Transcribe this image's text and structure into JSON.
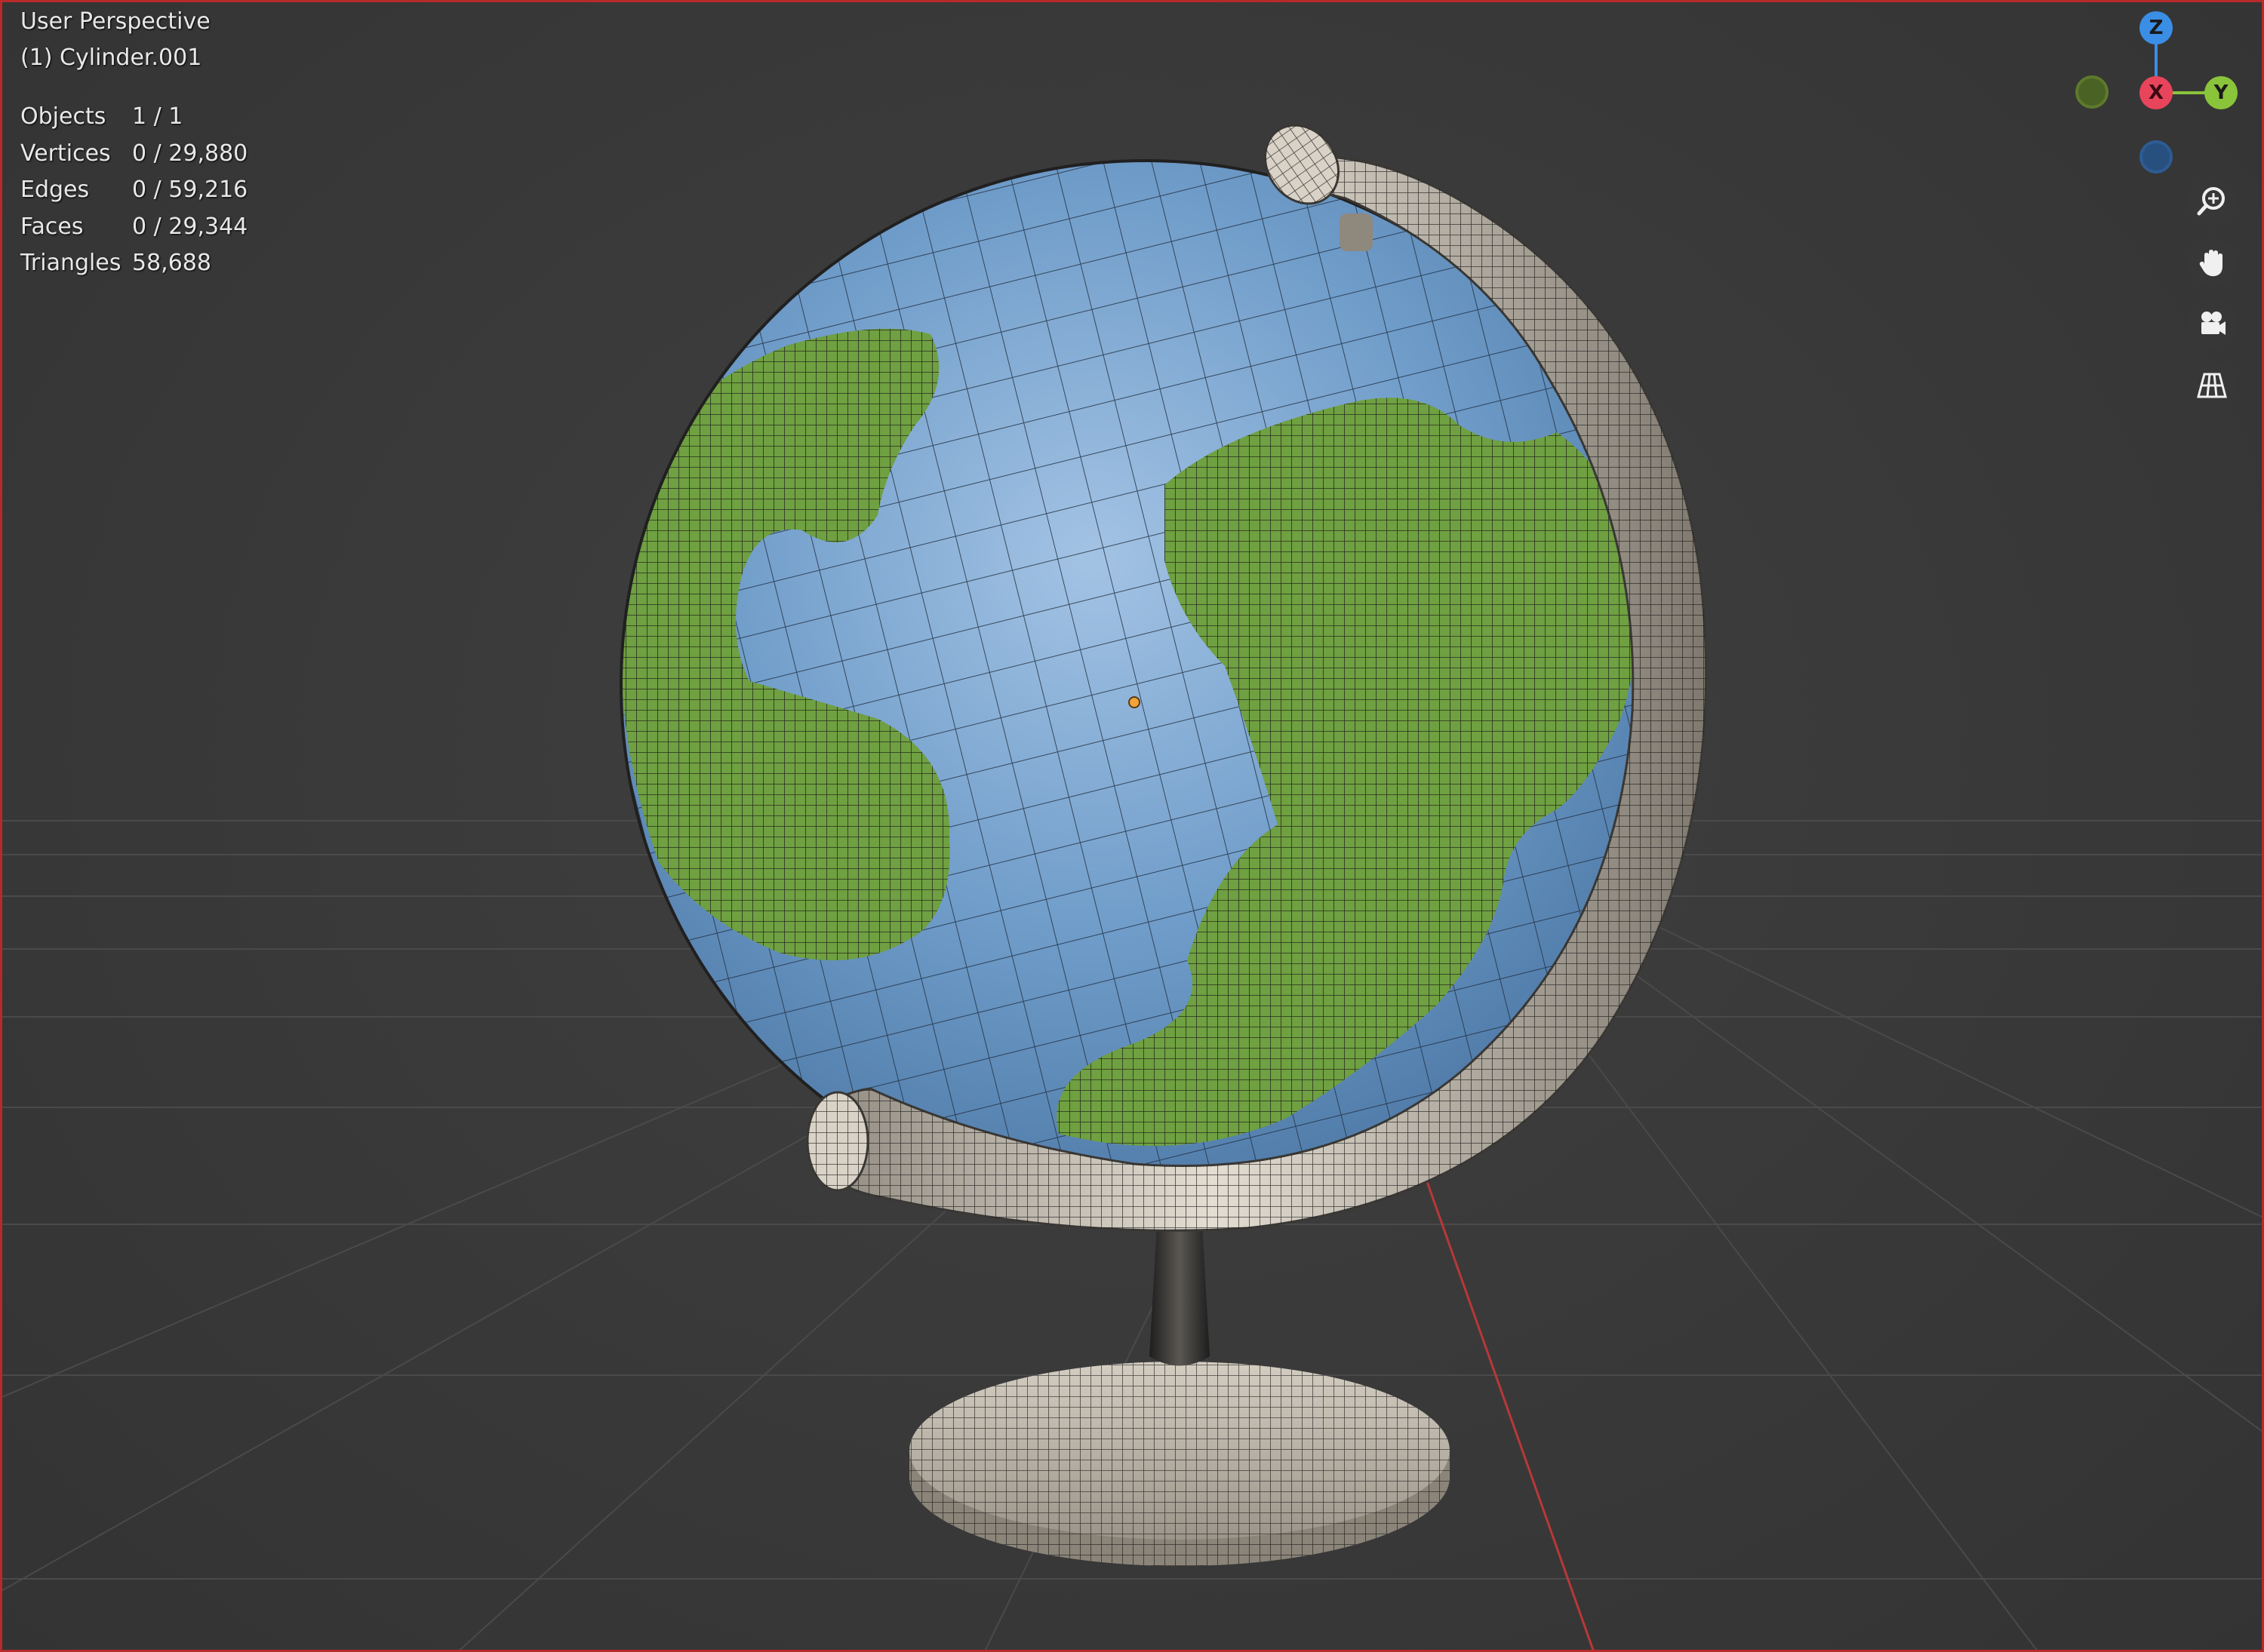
{
  "viewport": {
    "view_name": "User Perspective",
    "object_name": "(1) Cylinder.001"
  },
  "stats": [
    {
      "label": "Objects",
      "value": "1 / 1"
    },
    {
      "label": "Vertices",
      "value": "0 / 29,880"
    },
    {
      "label": "Edges",
      "value": "0 / 59,216"
    },
    {
      "label": "Faces",
      "value": "0 / 29,344"
    },
    {
      "label": "Triangles",
      "value": "58,688"
    }
  ],
  "gizmo": {
    "z_label": "Z",
    "x_label": "X",
    "y_label": "Y",
    "colors": {
      "x": "#e8455c",
      "y": "#8ac43a",
      "z": "#3a8ee6",
      "neg_y": "#5d7a2c",
      "neg_z": "#2d5c93"
    }
  },
  "nav_icons": [
    "zoom-icon",
    "hand-pan-icon",
    "camera-icon",
    "grid-perspective-icon"
  ],
  "colors": {
    "background": "#393939",
    "grid_line": "#4a4a4a",
    "x_axis_line": "#b83838",
    "ocean": "#6f9cc9",
    "land": "#6fa041",
    "metal": "#c9c1b3",
    "wire": "#1c1c1c"
  }
}
